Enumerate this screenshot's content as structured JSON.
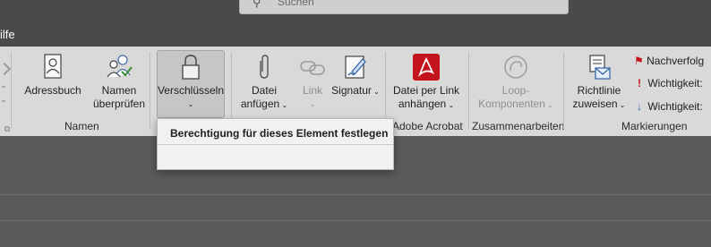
{
  "search": {
    "placeholder_text": "Suchen"
  },
  "menu": {
    "partial_tab": "ilfe"
  },
  "ribbon": {
    "groups": {
      "namen": {
        "label": "Namen",
        "adressbuch": "Adressbuch",
        "namen_pruefen_1": "Namen",
        "namen_pruefen_2": "überprüfen"
      },
      "verschluesseln": {
        "label": "Verschlüsseln",
        "caret": "⌄"
      },
      "anfuegen": {
        "datei_1": "Datei",
        "datei_2": "anfügen",
        "link": "Link",
        "signatur": "Signatur"
      },
      "adobe": {
        "label": "Adobe Acrobat",
        "button_1": "Datei per Link",
        "button_2": "anhängen"
      },
      "zusammenarbeiten": {
        "label": "Zusammenarbeiten",
        "loop_1": "Loop-",
        "loop_2": "Komponenten"
      },
      "markierungen": {
        "label": "Markierungen",
        "richtlinie_1": "Richtlinie",
        "richtlinie_2": "zuweisen",
        "nachverfolgung": "Nachverfolg",
        "wichtigkeit_hoch": "Wichtigkeit:",
        "wichtigkeit_niedrig": "Wichtigkeit:"
      }
    }
  },
  "dropdown": {
    "item": "Berechtigung für dieses Element festlegen"
  },
  "colors": {
    "ribbon_bg": "#d9d9d9",
    "app_bg": "#5a5a5a",
    "acrobat_red": "#c4141b"
  }
}
